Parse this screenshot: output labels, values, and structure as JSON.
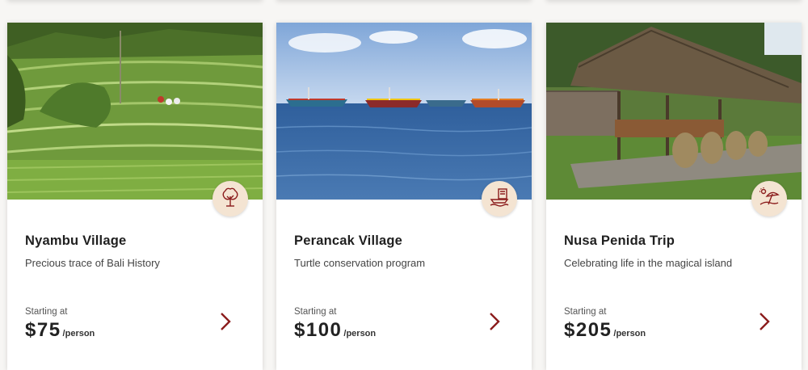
{
  "theme": {
    "accent": "#8b1c1c",
    "badge_bg": "#f4e4d2"
  },
  "cards": [
    {
      "title": "Nyambu Village",
      "subtitle": "Precious trace of Bali History",
      "starting_label": "Starting at",
      "price": "$75",
      "unit": "/person",
      "badge_icon": "tree-icon",
      "image": "rice-terraces-photo"
    },
    {
      "title": "Perancak Village",
      "subtitle": "Turtle conservation program",
      "starting_label": "Starting at",
      "price": "$100",
      "unit": "/person",
      "badge_icon": "boat-pier-icon",
      "image": "fishing-boats-sea-photo"
    },
    {
      "title": "Nusa Penida Trip",
      "subtitle": "Celebrating life in the magical island",
      "starting_label": "Starting at",
      "price": "$205",
      "unit": "/person",
      "badge_icon": "beach-umbrella-icon",
      "image": "thatched-hut-photo"
    }
  ]
}
